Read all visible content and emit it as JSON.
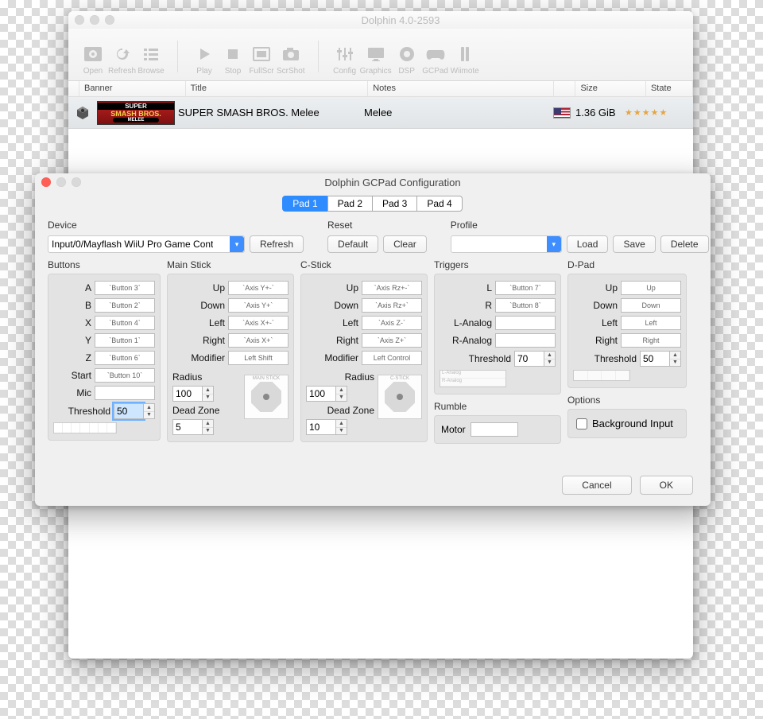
{
  "main": {
    "title": "Dolphin 4.0-2593",
    "toolbar": {
      "open": "Open",
      "refresh": "Refresh",
      "browse": "Browse",
      "play": "Play",
      "stop": "Stop",
      "fullscr": "FullScr",
      "scrshot": "ScrShot",
      "config": "Config",
      "graphics": "Graphics",
      "dsp": "DSP",
      "gcpad": "GCPad",
      "wiimote": "Wiimote"
    },
    "columns": {
      "banner": "Banner",
      "title": "Title",
      "notes": "Notes",
      "size": "Size",
      "state": "State"
    },
    "row": {
      "art1": "SUPER",
      "art2": "SMASH BROS.",
      "art3": "MELEE",
      "title": "SUPER SMASH BROS. Melee",
      "notes": "Melee",
      "size": "1.36 GiB",
      "stars": "★★★★★"
    }
  },
  "dialog": {
    "title": "Dolphin GCPad Configuration",
    "tabs": [
      "Pad 1",
      "Pad 2",
      "Pad 3",
      "Pad 4"
    ],
    "device_label": "Device",
    "device_value": "Input/0/Mayflash WiiU Pro Game Cont",
    "refresh": "Refresh",
    "reset_label": "Reset",
    "default": "Default",
    "clear": "Clear",
    "profile_label": "Profile",
    "load": "Load",
    "save": "Save",
    "delete": "Delete",
    "buttons": {
      "label": "Buttons",
      "A": "A",
      "B": "B",
      "X": "X",
      "Y": "Y",
      "Z": "Z",
      "Start": "Start",
      "Mic": "Mic",
      "Threshold": "Threshold",
      "Av": "`Button 3`",
      "Bv": "`Button 2`",
      "Xv": "`Button 4`",
      "Yv": "`Button 1`",
      "Zv": "`Button 6`",
      "Startv": "`Button 10`",
      "Micv": "",
      "thr": "50"
    },
    "main_stick": {
      "label": "Main Stick",
      "Up": "Up",
      "Down": "Down",
      "Left": "Left",
      "Right": "Right",
      "Modifier": "Modifier",
      "Upv": "`Axis Y+-`",
      "Downv": "`Axis Y+`",
      "Leftv": "`Axis X+-`",
      "Rightv": "`Axis X+`",
      "Modv": "Left Shift",
      "Radius": "Radius",
      "rv": "100",
      "Dead": "Dead Zone",
      "dv": "5",
      "ind": "MAIN STICK"
    },
    "c_stick": {
      "label": "C-Stick",
      "Up": "Up",
      "Down": "Down",
      "Left": "Left",
      "Right": "Right",
      "Modifier": "Modifier",
      "Upv": "`Axis Rz+-`",
      "Downv": "`Axis Rz+`",
      "Leftv": "`Axis Z-`",
      "Rightv": "`Axis Z+`",
      "Modv": "Left Control",
      "Radius": "Radius",
      "rv": "100",
      "Dead": "Dead Zone",
      "dv": "10",
      "ind": "C-STICK"
    },
    "triggers": {
      "label": "Triggers",
      "L": "L",
      "R": "R",
      "La": "L-Analog",
      "Ra": "R-Analog",
      "Lv": "`Button 7`",
      "Rv": "`Button 8`",
      "Lav": "",
      "Rav": "",
      "Threshold": "Threshold",
      "thr": "70"
    },
    "dpad": {
      "label": "D-Pad",
      "Up": "Up",
      "Down": "Down",
      "Left": "Left",
      "Right": "Right",
      "Upv": "Up",
      "Downv": "Down",
      "Leftv": "Left",
      "Rightv": "Right",
      "Threshold": "Threshold",
      "thr": "50"
    },
    "rumble": {
      "label": "Rumble",
      "Motor": "Motor"
    },
    "options": {
      "label": "Options",
      "bg": "Background Input"
    },
    "cancel": "Cancel",
    "ok": "OK"
  }
}
